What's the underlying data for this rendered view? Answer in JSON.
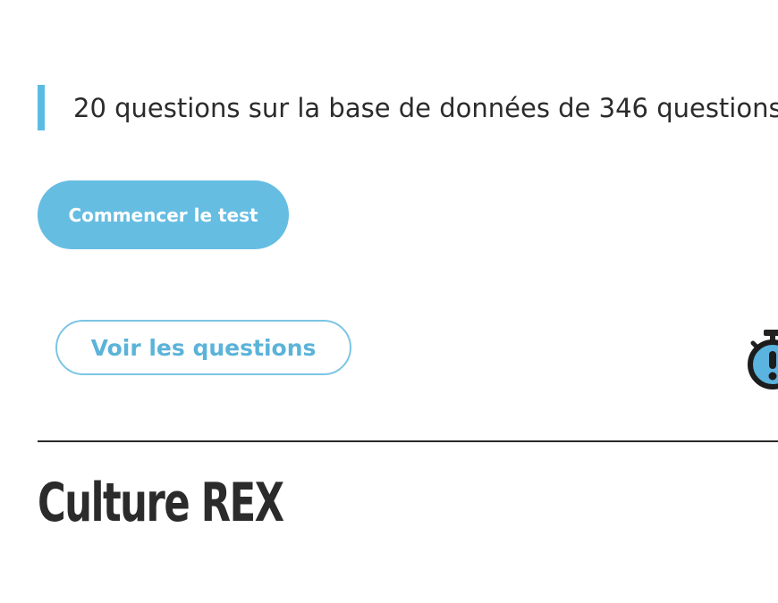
{
  "quiz": {
    "info_text": "20 questions sur la base de données de 346 questions",
    "start_button_label": "Commencer le test",
    "view_questions_label": "Voir les questions"
  },
  "next_section": {
    "title": "Culture REX"
  },
  "colors": {
    "accent": "#66bde2",
    "accent_border": "#7cc5e4",
    "text": "#2b2b2b"
  },
  "icons": {
    "timer": "stopwatch-alert-icon"
  }
}
